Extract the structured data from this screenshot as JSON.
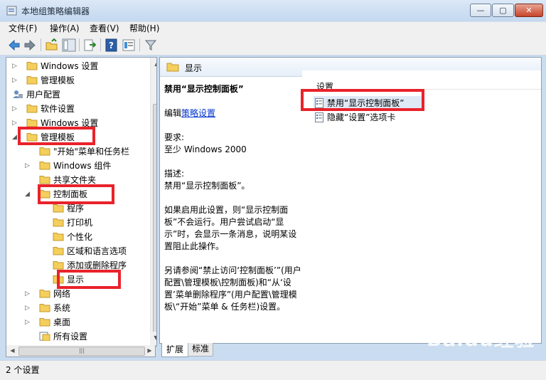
{
  "window": {
    "title": "本地组策略编辑器",
    "min": "—",
    "max": "▢",
    "close": "✕"
  },
  "menu": [
    "文件(F)",
    "操作(A)",
    "查看(V)",
    "帮助(H)"
  ],
  "tree": {
    "nodes": [
      {
        "label": "Windows 设置",
        "kind": "folder"
      },
      {
        "label": "管理模板",
        "kind": "folder"
      },
      {
        "label": "用户配置",
        "kind": "user"
      },
      {
        "label": "软件设置",
        "kind": "folder"
      },
      {
        "label": "Windows 设置",
        "kind": "folder"
      },
      {
        "label": "管理模板",
        "kind": "folder"
      },
      {
        "label": "\"开始\"菜单和任务栏",
        "kind": "folder"
      },
      {
        "label": "Windows 组件",
        "kind": "folder"
      },
      {
        "label": "共享文件夹",
        "kind": "folder"
      },
      {
        "label": "控制面板",
        "kind": "folder"
      },
      {
        "label": "程序",
        "kind": "folder"
      },
      {
        "label": "打印机",
        "kind": "folder"
      },
      {
        "label": "个性化",
        "kind": "folder"
      },
      {
        "label": "区域和语言选项",
        "kind": "folder"
      },
      {
        "label": "添加或删除程序",
        "kind": "folder"
      },
      {
        "label": "显示",
        "kind": "folder"
      },
      {
        "label": "网络",
        "kind": "folder"
      },
      {
        "label": "系统",
        "kind": "folder"
      },
      {
        "label": "桌面",
        "kind": "folder"
      },
      {
        "label": "所有设置",
        "kind": "allsettings"
      }
    ],
    "hscroll_thumb": "|||"
  },
  "right": {
    "header": "显示",
    "setting_title": "禁用“显示控制面板”",
    "edit_prefix": "编辑",
    "edit_link": "策略设置",
    "requirements_label": "要求:",
    "requirements_value": "至少 Windows 2000",
    "description_label": "描述:",
    "description_value": "禁用“显示控制面板”。",
    "detail": "如果启用此设置，则“显示控制面板”不会运行。用户尝试启动“显示”时，会显示一条消息，说明某设置阻止此操作。",
    "see_also": "另请参阅“禁止访问‘控制面板’”(用户配置\\管理模板\\控制面板)和“从‘设置’菜单删除程序”(用户配置\\管理模板\\“开始”菜单 & 任务栏)设置。",
    "list_header": "设置",
    "list_items": [
      "禁用“显示控制面板”",
      "隐藏“设置”选项卡"
    ]
  },
  "tabs": [
    "扩展",
    "标准"
  ],
  "status": "2 个设置",
  "watermark": "Baidu经验",
  "colors": {
    "highlight": "#e9222b",
    "link": "#0033cc",
    "folder": "#f5cf5b"
  }
}
